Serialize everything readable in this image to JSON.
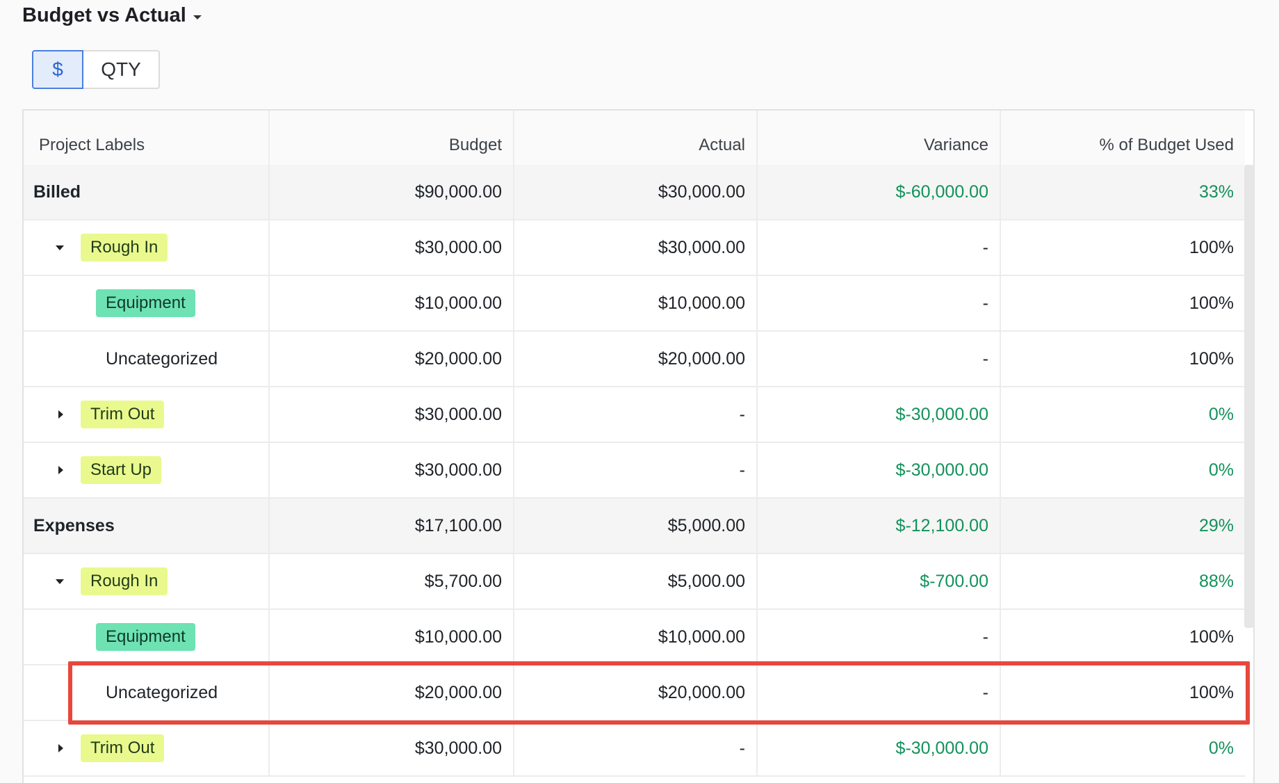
{
  "header": {
    "title": "Budget vs Actual"
  },
  "toggle": {
    "dollar": "$",
    "qty": "QTY"
  },
  "columns": [
    "Project Labels",
    "Budget",
    "Actual",
    "Variance",
    "% of Budget Used"
  ],
  "rows": [
    {
      "label": "Billed",
      "level": 0,
      "budget": "$90,000.00",
      "actual": "$30,000.00",
      "variance": "$-60,000.00",
      "percent": "33%",
      "highlight": true
    },
    {
      "label": "Rough In",
      "level": 1,
      "expanded": true,
      "budget": "$30,000.00",
      "actual": "$30,000.00",
      "variance": "-",
      "percent": "100%",
      "highlight": false
    },
    {
      "label": "Equipment",
      "level": 2,
      "tag": true,
      "budget": "$10,000.00",
      "actual": "$10,000.00",
      "variance": "-",
      "percent": "100%",
      "highlight": false
    },
    {
      "label": "Uncategorized",
      "level": 2,
      "tag": false,
      "budget": "$20,000.00",
      "actual": "$20,000.00",
      "variance": "-",
      "percent": "100%",
      "highlight": false
    },
    {
      "label": "Trim Out",
      "level": 1,
      "expanded": false,
      "budget": "$30,000.00",
      "actual": "-",
      "variance": "$-30,000.00",
      "percent": "0%",
      "highlight": true
    },
    {
      "label": "Start Up",
      "level": 1,
      "expanded": false,
      "budget": "$30,000.00",
      "actual": "-",
      "variance": "$-30,000.00",
      "percent": "0%",
      "highlight": true
    },
    {
      "label": "Expenses",
      "level": 0,
      "budget": "$17,100.00",
      "actual": "$5,000.00",
      "variance": "$-12,100.00",
      "percent": "29%",
      "highlight": true
    },
    {
      "label": "Rough In",
      "level": 1,
      "expanded": true,
      "budget": "$5,700.00",
      "actual": "$5,000.00",
      "variance": "$-700.00",
      "percent": "88%",
      "highlight": true
    },
    {
      "label": "Equipment",
      "level": 2,
      "tag": true,
      "budget": "$10,000.00",
      "actual": "$10,000.00",
      "variance": "-",
      "percent": "100%",
      "highlight": false
    },
    {
      "label": "Uncategorized",
      "level": 2,
      "tag": false,
      "budget": "$20,000.00",
      "actual": "$20,000.00",
      "variance": "-",
      "percent": "100%",
      "highlight": false
    },
    {
      "label": "Trim Out",
      "level": 1,
      "expanded": false,
      "budget": "$30,000.00",
      "actual": "-",
      "variance": "$-30,000.00",
      "percent": "0%",
      "highlight": true
    }
  ],
  "colors": {
    "positive": "#13915b",
    "highlight_border": "#e8473d",
    "tag_level1": "#eaf98e",
    "tag_level2": "#6ee2b3",
    "toggle_active": "#4a7fe0"
  }
}
